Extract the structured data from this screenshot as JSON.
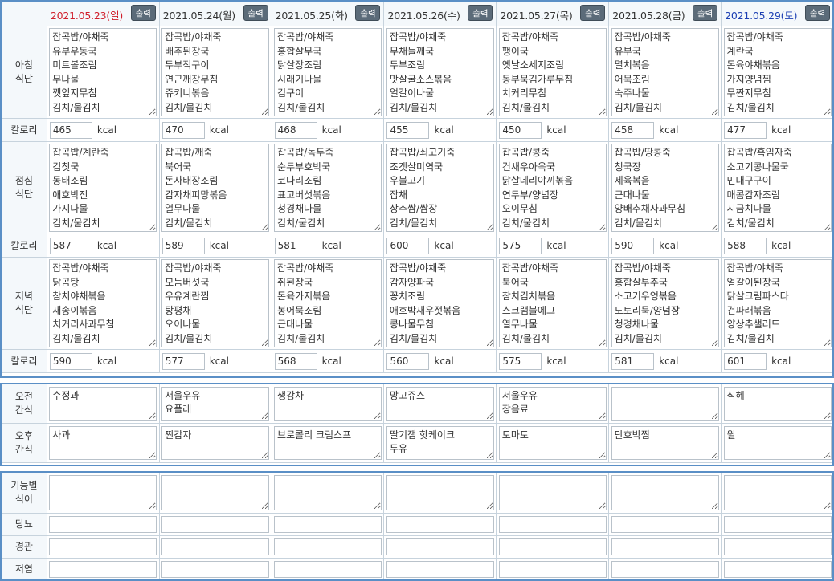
{
  "headers": [
    {
      "date": "2021.05.23(일)",
      "print_label": "출력",
      "day_type": "sun"
    },
    {
      "date": "2021.05.24(월)",
      "print_label": "출력",
      "day_type": "weekday"
    },
    {
      "date": "2021.05.25(화)",
      "print_label": "출력",
      "day_type": "weekday"
    },
    {
      "date": "2021.05.26(수)",
      "print_label": "출력",
      "day_type": "weekday"
    },
    {
      "date": "2021.05.27(목)",
      "print_label": "출력",
      "day_type": "weekday"
    },
    {
      "date": "2021.05.28(금)",
      "print_label": "출력",
      "day_type": "weekday"
    },
    {
      "date": "2021.05.29(토)",
      "print_label": "출력",
      "day_type": "sat"
    }
  ],
  "labels": {
    "breakfast": "아침\n식단",
    "lunch": "점심\n식단",
    "dinner": "저녁\n식단",
    "calorie": "칼로리",
    "am_snack": "오전\n간식",
    "pm_snack": "오후\n간식",
    "functional": "기능별\n식이",
    "diabetes": "당뇨",
    "tube": "경관",
    "low_salt": "저염"
  },
  "calorie_unit": "kcal",
  "breakfast": [
    "잡곡밥/야채죽\n유부우동국\n미트볼조림\n무나물\n깻잎지무침\n김치/물김치",
    "잡곡밥/야채죽\n배추된장국\n두부적구이\n연근깨장무침\n쥬키니볶음\n김치/물김치",
    "잡곡밥/야채죽\n홍합살무국\n닭살장조림\n시래기나물\n김구이\n김치/물김치",
    "잡곡밥/야채죽\n무채들깨국\n두부조림\n맛살굴소스볶음\n얼갈이나물\n김치/물김치",
    "잡곡밥/야채죽\n팽이국\n옛날소세지조림\n동부묵김가루무침\n치커리무침\n김치/물김치",
    "잡곡밥/야채죽\n유부국\n멸치볶음\n어묵조림\n숙주나물\n김치/물김치",
    "잡곡밥/야채죽\n계란국\n돈육야채볶음\n가지양념찜\n무짠지무침\n김치/물김치"
  ],
  "breakfast_cal": [
    "465",
    "470",
    "468",
    "455",
    "450",
    "458",
    "477"
  ],
  "lunch": [
    "잡곡밥/계란죽\n김칫국\n동태조림\n애호박전\n가지나물\n김치/물김치",
    "잡곡밥/깨죽\n북어국\n돈사태장조림\n감자채피망볶음\n열무나물\n김치/물김치",
    "잡곡밥/녹두죽\n순두부호박국\n코다리조림\n표고버섯볶음\n청경채나물\n김치/물김치",
    "잡곡밥/쇠고기죽\n조갯살미역국\n우불고기\n잡채\n상추쌈/쌈장\n김치/물김치",
    "잡곡밥/콩죽\n건새우아욱국\n닭살데리야끼볶음\n연두부/양념장\n오이무침\n김치/물김치",
    "잡곡밥/땅콩죽\n청국장\n제육볶음\n근대나물\n양배추채사과무침\n김치/물김치",
    "잡곡밥/흑임자죽\n소고기콩나물국\n민대구구이\n매콤감자조림\n시금치나물\n김치/물김치"
  ],
  "lunch_cal": [
    "587",
    "589",
    "581",
    "600",
    "575",
    "590",
    "588"
  ],
  "dinner": [
    "잡곡밥/야채죽\n닭곰탕\n참치야채볶음\n새송이볶음\n치커리사과무침\n김치/물김치",
    "잡곡밥/야채죽\n모듬버섯국\n우유계란찜\n탕평채\n오이나물\n김치/물김치",
    "잡곡밥/야채죽\n취된장국\n돈육가지볶음\n봉어묵조림\n근대나물\n김치/물김치",
    "잡곡밥/야채죽\n감자양파국\n꽁치조림\n애호박새우젓볶음\n콩나물무침\n김치/물김치",
    "잡곡밥/야채죽\n북어국\n참치김치볶음\n스크램블에그\n열무나물\n김치/물김치",
    "잡곡밥/야채죽\n홍합살부추국\n소고기우엉볶음\n도토리묵/양념장\n청경채나물\n김치/물김치",
    "잡곡밥/야채죽\n얼갈이된장국\n닭살크림파스타\n건파래볶음\n양상추샐러드\n김치/물김치"
  ],
  "dinner_cal": [
    "590",
    "577",
    "568",
    "560",
    "575",
    "581",
    "601"
  ],
  "am_snack": [
    "수정과",
    "서울우유\n요플레",
    "생강차",
    "망고쥬스",
    "서울우유\n장음료",
    "",
    "식혜"
  ],
  "pm_snack": [
    "사과",
    "찐감자",
    "브로콜리 크림스프",
    "딸기잼 핫케이크\n두유",
    "토마토",
    "단호박찜",
    "윌"
  ]
}
